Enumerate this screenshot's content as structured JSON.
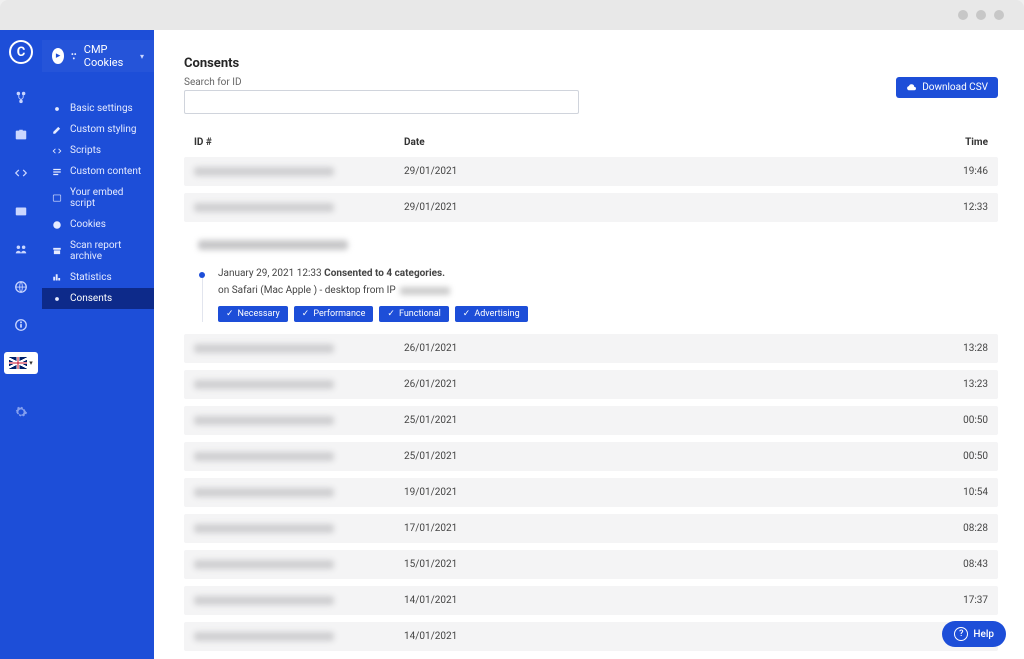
{
  "header_title": "CMP Cookies",
  "nav": [
    {
      "icon": "gear",
      "label": "Basic settings"
    },
    {
      "icon": "pencil",
      "label": "Custom styling"
    },
    {
      "icon": "code",
      "label": "Scripts"
    },
    {
      "icon": "text",
      "label": "Custom content"
    },
    {
      "icon": "embed",
      "label": "Your embed script"
    },
    {
      "icon": "cookie",
      "label": "Cookies"
    },
    {
      "icon": "archive",
      "label": "Scan report archive"
    },
    {
      "icon": "chart",
      "label": "Statistics"
    },
    {
      "icon": "gear",
      "label": "Consents"
    }
  ],
  "active_nav_index": 8,
  "page": {
    "title": "Consents",
    "search_label": "Search for ID",
    "download_label": "Download CSV"
  },
  "columns": {
    "id": "ID #",
    "date": "Date",
    "time": "Time"
  },
  "rows_before": [
    {
      "date": "29/01/2021",
      "time": "19:46"
    },
    {
      "date": "29/01/2021",
      "time": "12:33"
    }
  ],
  "detail": {
    "timestamp": "January 29, 2021 12:33",
    "headline": "Consented to 4 categories.",
    "meta": "on Safari (Mac Apple ) - desktop from IP",
    "categories": [
      "Necessary",
      "Performance",
      "Functional",
      "Advertising"
    ]
  },
  "rows_after": [
    {
      "date": "26/01/2021",
      "time": "13:28"
    },
    {
      "date": "26/01/2021",
      "time": "13:23"
    },
    {
      "date": "25/01/2021",
      "time": "00:50"
    },
    {
      "date": "25/01/2021",
      "time": "00:50"
    },
    {
      "date": "19/01/2021",
      "time": "10:54"
    },
    {
      "date": "17/01/2021",
      "time": "08:28"
    },
    {
      "date": "15/01/2021",
      "time": "08:43"
    },
    {
      "date": "14/01/2021",
      "time": "17:37"
    },
    {
      "date": "14/01/2021",
      "time": ""
    }
  ],
  "help_label": "Help"
}
